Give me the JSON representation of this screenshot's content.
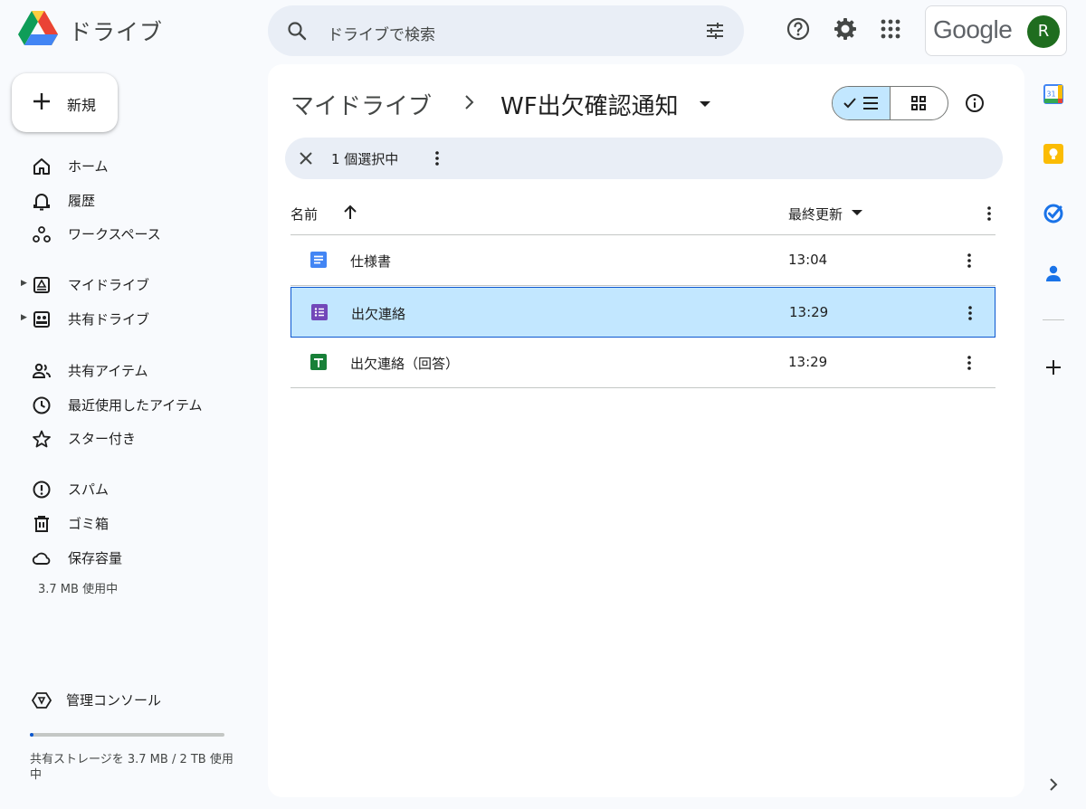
{
  "header": {
    "app_name": "ドライブ",
    "search_placeholder": "ドライブで検索",
    "account_brand": "Google",
    "avatar_initial": "R"
  },
  "sidebar": {
    "new_label": "新規",
    "items": [
      {
        "label": "ホーム",
        "icon": "home-icon"
      },
      {
        "label": "履歴",
        "icon": "bell-icon"
      },
      {
        "label": "ワークスペース",
        "icon": "workspaces-icon"
      },
      {
        "label": "マイドライブ",
        "icon": "my-drive-icon",
        "expandable": true
      },
      {
        "label": "共有ドライブ",
        "icon": "shared-drives-icon",
        "expandable": true
      },
      {
        "label": "共有アイテム",
        "icon": "people-icon"
      },
      {
        "label": "最近使用したアイテム",
        "icon": "clock-icon"
      },
      {
        "label": "スター付き",
        "icon": "star-icon"
      },
      {
        "label": "スパム",
        "icon": "spam-icon"
      },
      {
        "label": "ゴミ箱",
        "icon": "trash-icon"
      },
      {
        "label": "保存容量",
        "icon": "cloud-icon"
      }
    ],
    "storage_used": "3.7 MB 使用中",
    "admin_label": "管理コンソール",
    "shared_storage": "共有ストレージを 3.7 MB / 2 TB 使用中",
    "shared_storage_fraction": 0.01
  },
  "main": {
    "breadcrumb_root": "マイドライブ",
    "breadcrumb_folder": "WF出欠確認通知",
    "selection_text": "1 個選択中",
    "columns": {
      "name": "名前",
      "modified": "最終更新"
    },
    "files": [
      {
        "name": "仕様書",
        "modified": "13:04",
        "type": "docs",
        "color": "#4285f4",
        "selected": false
      },
      {
        "name": "出欠連絡",
        "modified": "13:29",
        "type": "forms",
        "color": "#7248b9",
        "selected": true
      },
      {
        "name": "出欠連絡（回答）",
        "modified": "13:29",
        "type": "sheets",
        "color": "#188038",
        "selected": false
      }
    ]
  },
  "rail": {
    "calendar_day": "31"
  },
  "colors": {
    "accent": "#0b57d0",
    "selected_bg": "#c2e7ff",
    "search_bg": "#e9eef6"
  }
}
